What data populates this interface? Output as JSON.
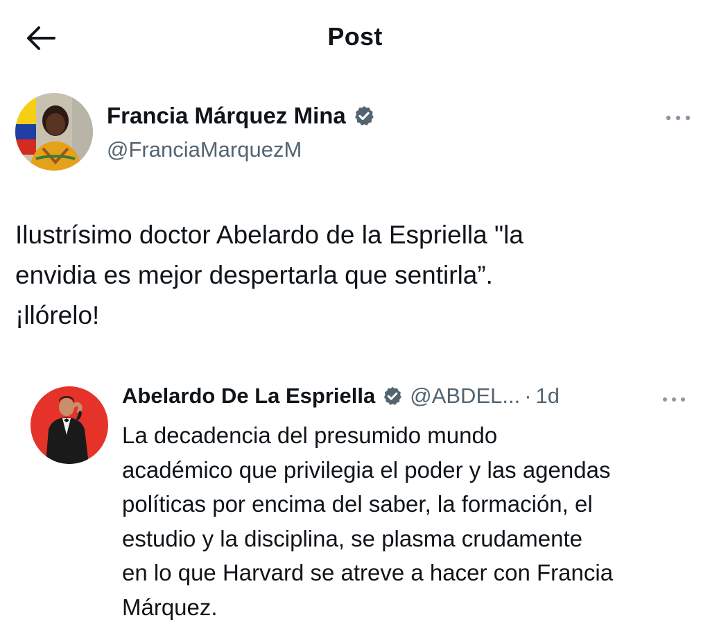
{
  "header": {
    "back_icon": "arrow-left-icon",
    "title": "Post"
  },
  "post": {
    "author": {
      "name": "Francia Márquez Mina",
      "handle": "@FranciaMarquezM",
      "verified": true,
      "avatar_icon": "avatar-francia"
    },
    "more_icon": "more-horizontal-icon",
    "text_lines": [
      "Ilustrísimo doctor Abelardo de la Espriella \"la",
      "envidia es mejor despertarla que sentirla”.",
      "¡llórelo!"
    ]
  },
  "quoted": {
    "author": {
      "name": "Abelardo De La Espriella",
      "handle": "@ABDEL...",
      "verified": true,
      "avatar_icon": "avatar-abelardo"
    },
    "separator": "·",
    "time": "1d",
    "more_icon": "more-horizontal-icon",
    "text_lines": [
      "La decadencia del presumido mundo",
      "académico que privilegia el poder y las agendas",
      "políticas por encima del saber, la formación, el",
      "estudio y la disciplina, se plasma crudamente",
      "en lo que Harvard se atreve a hacer con Francia",
      "Márquez."
    ]
  },
  "colors": {
    "text_primary": "#0f1419",
    "text_secondary": "#536471",
    "verified_badge": "#536471",
    "more_dots": "#8b98a5",
    "quote_avatar_bg": "#e5332a"
  }
}
